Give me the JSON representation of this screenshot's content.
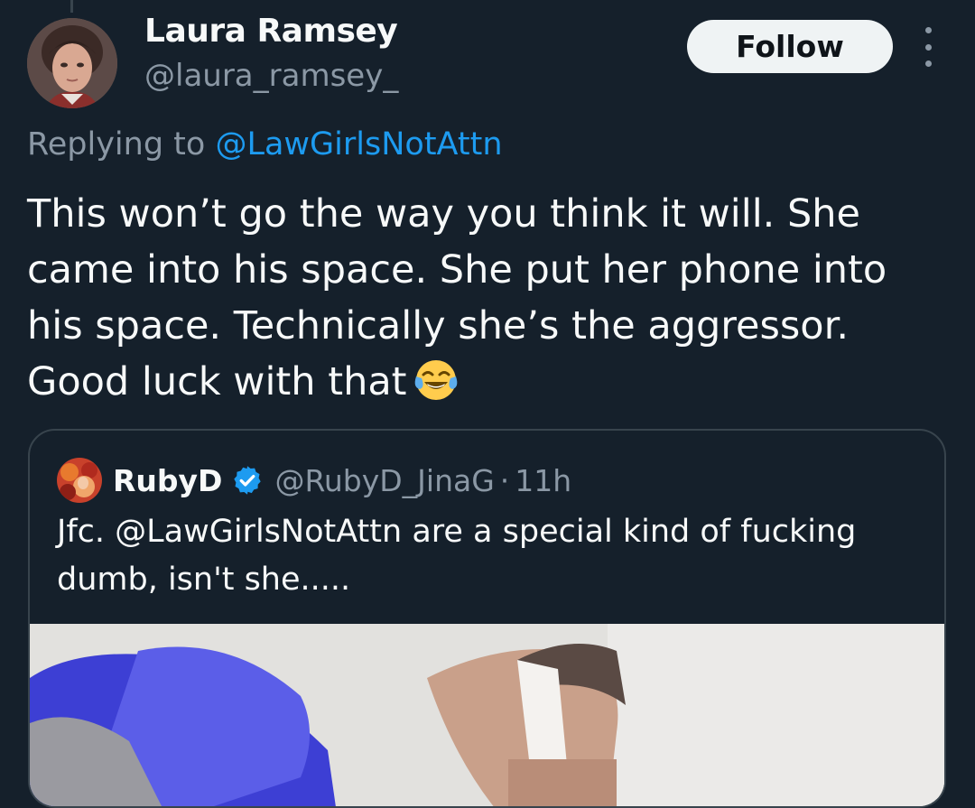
{
  "tweet": {
    "author": {
      "name": "Laura Ramsey",
      "handle": "@laura_ramsey_"
    },
    "follow_label": "Follow",
    "replying_prefix": "Replying to",
    "replying_to": "@LawGirlsNotAttn",
    "text_lines": [
      "This won’t go the way you think it will. She",
      "came into his space. She put her phone into",
      "his space. Technically she’s the aggressor.",
      "Good luck with that"
    ],
    "emoji": "face-with-tears-of-joy"
  },
  "quote": {
    "name": "RubyD",
    "handle": "@RubyD_JinaG",
    "separator": "·",
    "time": "11h",
    "text_prefix": "Jfc. ",
    "text_mention": "@LawGirlsNotAttn",
    "text_rest": " are a special kind of fucking dumb, isn't she....."
  },
  "colors": {
    "background": "#15202b",
    "primary_text": "#f7f9f9",
    "secondary_text": "#8b98a5",
    "link": "#1d9bf0",
    "border": "#38444d",
    "follow_button_bg": "#eff3f4"
  }
}
